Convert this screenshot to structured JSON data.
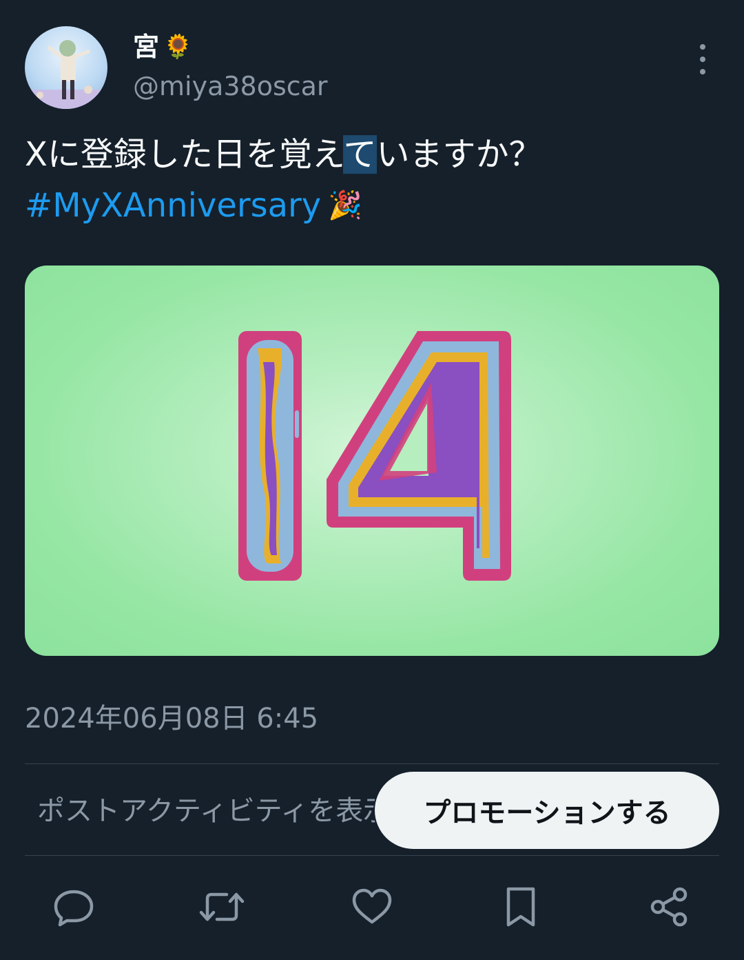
{
  "user": {
    "display_name": "宮",
    "name_emoji": "🌻",
    "handle": "@miya38oscar"
  },
  "tweet": {
    "text_before": "Xに登録した日を覚え",
    "text_selected": "て",
    "text_after": "いますか？",
    "hashtag": "#MyXAnniversary",
    "hashtag_emoji": "🎉",
    "media_number": "14",
    "timestamp": "2024年06月08日 6:45"
  },
  "activity": {
    "label": "ポストアクティビティを表示"
  },
  "promote": {
    "label": "プロモーションする"
  },
  "actions": [
    "reply-icon",
    "retweet-icon",
    "like-icon",
    "bookmark-icon",
    "share-icon"
  ],
  "colors": {
    "background": "#15202b",
    "link": "#1d9bf0",
    "muted": "#8b98a5",
    "media_bg": "#96e6a4"
  }
}
